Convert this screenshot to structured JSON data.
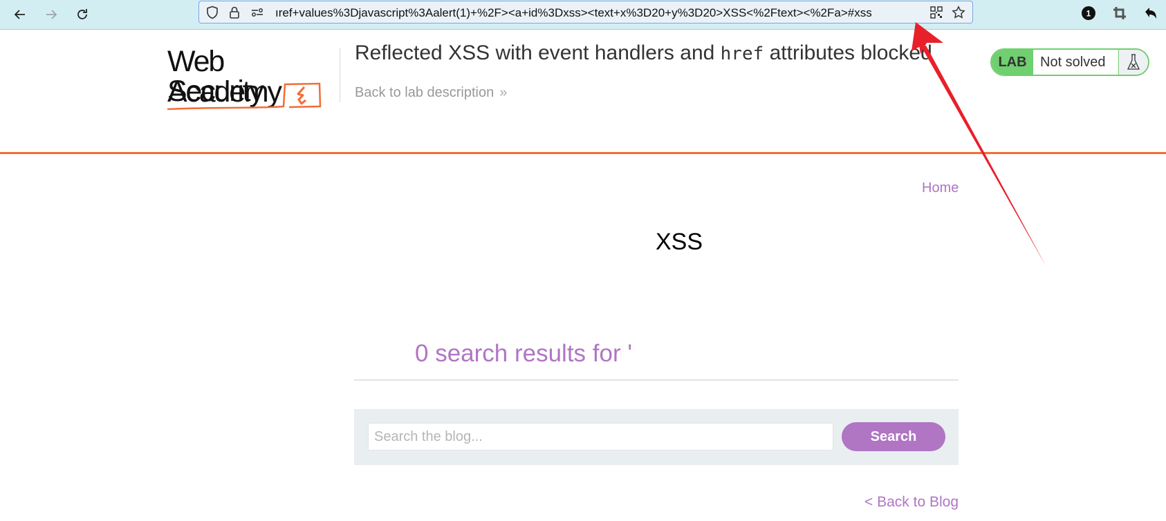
{
  "browser": {
    "nav": {
      "back_icon": "arrow-left-icon",
      "forward_icon": "arrow-right-icon",
      "reload_icon": "reload-icon"
    },
    "url_bar": {
      "shield_icon": "shield-icon",
      "lock_icon": "lock-icon",
      "permissions_icon": "permissions-icon",
      "url_visible": "ıref+values%3Djavascript%3Aalert(1)+%2F><a+id%3Dxss><text+x%3D20+y%3D20>XSS<%2Ftext><%2Fa>#xss",
      "qr_icon": "qr-code-icon",
      "bookmark_icon": "star-icon"
    },
    "toolbar": {
      "notification_badge": "1",
      "crop_icon": "crop-icon",
      "undo_icon": "undo-icon"
    }
  },
  "header": {
    "logo": {
      "line1": "Web Security",
      "line2": "Academy"
    },
    "lab_title_prefix": "Reflected XSS with event handlers and ",
    "lab_title_code": "href",
    "lab_title_suffix": " attributes blocked",
    "back_to_description": "Back to lab description",
    "back_chevron": "»",
    "lab_badge": {
      "label": "LAB",
      "status": "Not solved",
      "flask_icon": "flask-icon"
    }
  },
  "colors": {
    "accent_orange": "#f26c35",
    "link_purple": "#b075c3",
    "lab_green": "#70cf6f",
    "annotation_red": "#e8202a"
  },
  "nav": {
    "home": "Home"
  },
  "injected_svg_text": "XSS",
  "search": {
    "results_text": "0 search results for '",
    "placeholder": "Search the blog...",
    "value": "",
    "button_label": "Search"
  },
  "footer": {
    "back_to_blog": "< Back to Blog"
  }
}
